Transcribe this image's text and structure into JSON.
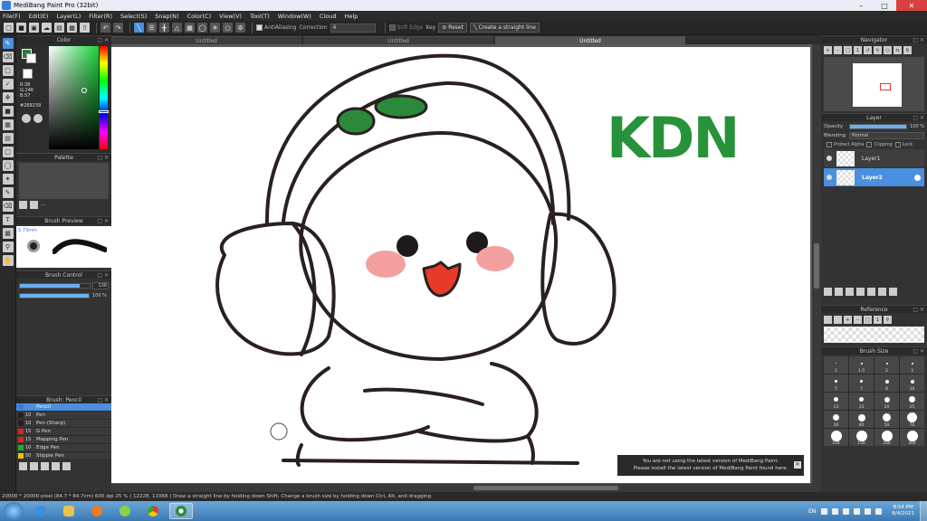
{
  "window": {
    "title": "MediBang Paint Pro (32bit)"
  },
  "menu": [
    "File(F)",
    "Edit(E)",
    "Layer(L)",
    "Filter(R)",
    "Select(S)",
    "Snap(N)",
    "Color(C)",
    "View(V)",
    "Tool(T)",
    "Window(W)",
    "Cloud",
    "Help"
  ],
  "toolbar": {
    "antialiasing_label": "AntiAliasing",
    "correction_label": "Correction",
    "correction_value": "4",
    "soft_edge_label": "Soft Edge",
    "key_label": "Key",
    "reset_label": "Reset",
    "straight_line_label": "Create a straight line"
  },
  "tabs": [
    "Untitled",
    "Untitled",
    "Untitled"
  ],
  "color_panel": {
    "title": "Color",
    "rgb_text": [
      "R:38",
      "G:146",
      "B:57"
    ],
    "hex": "#269239",
    "fg_color": "#269239"
  },
  "palette_panel": {
    "title": "Palette",
    "more": "..."
  },
  "brush_preview": {
    "title": "Brush Preview",
    "size_text": "5.73mm"
  },
  "brush_control": {
    "title": "Brush Control",
    "size_value": "136",
    "opacity_value": "100 %",
    "size_fraction": 0.86,
    "opacity_fraction": 1.0
  },
  "brush_list": {
    "title": "Brush: Pencil",
    "items": [
      {
        "size": "",
        "name": "Pencil",
        "color": "#3a7bd5",
        "selected": true
      },
      {
        "size": "10",
        "name": "Pen",
        "color": "#222222",
        "selected": false
      },
      {
        "size": "10",
        "name": "Pen (Sharp)",
        "color": "#222222",
        "selected": false
      },
      {
        "size": "15",
        "name": "G Pen",
        "color": "#e02020",
        "selected": false
      },
      {
        "size": "15",
        "name": "Mapping Pen",
        "color": "#e02020",
        "selected": false
      },
      {
        "size": "10",
        "name": "Edge Pen",
        "color": "#20b020",
        "selected": false
      },
      {
        "size": "50",
        "name": "Stipple Pen",
        "color": "#e8c020",
        "selected": false
      }
    ]
  },
  "navigator": {
    "title": "Navigator"
  },
  "layer_panel": {
    "title": "Layer",
    "opacity_label": "Opacity",
    "opacity_value": "100 %",
    "opacity_fraction": 1.0,
    "blending_label": "Blending",
    "blending_value": "Normal",
    "protect_alpha": "Protect Alpha",
    "clipping": "Clipping",
    "lock": "Lock",
    "layers": [
      {
        "name": "Layer1",
        "selected": false
      },
      {
        "name": "Layer2",
        "selected": true
      }
    ]
  },
  "reference_panel": {
    "title": "Reference"
  },
  "brush_size_panel": {
    "title": "Brush Size",
    "sizes": [
      "1",
      "1.5",
      "2",
      "3",
      "5",
      "7",
      "8",
      "10",
      "13",
      "15",
      "20",
      "25",
      "30",
      "40",
      "50",
      "70",
      "100",
      "150",
      "200",
      "300"
    ]
  },
  "canvas": {
    "watermark_text": "KDN",
    "watermark_color": "#269239"
  },
  "notice": {
    "line1": "You are not using the latest version of MediBang Paint.",
    "line2": "Please install the latest version of MediBang Paint found here."
  },
  "status_bar": {
    "text": "20000 * 20000 pixel   (84.7 * 84.7cm)   600 dpi   25 %   ( 12228, 11068 )   Draw a straight line by holding down Shift, Change a brush size by holding down Ctrl, Alt, and dragging"
  },
  "taskbar": {
    "lang": "EN",
    "time": "8:54 PM",
    "date": "8/4/2021"
  }
}
